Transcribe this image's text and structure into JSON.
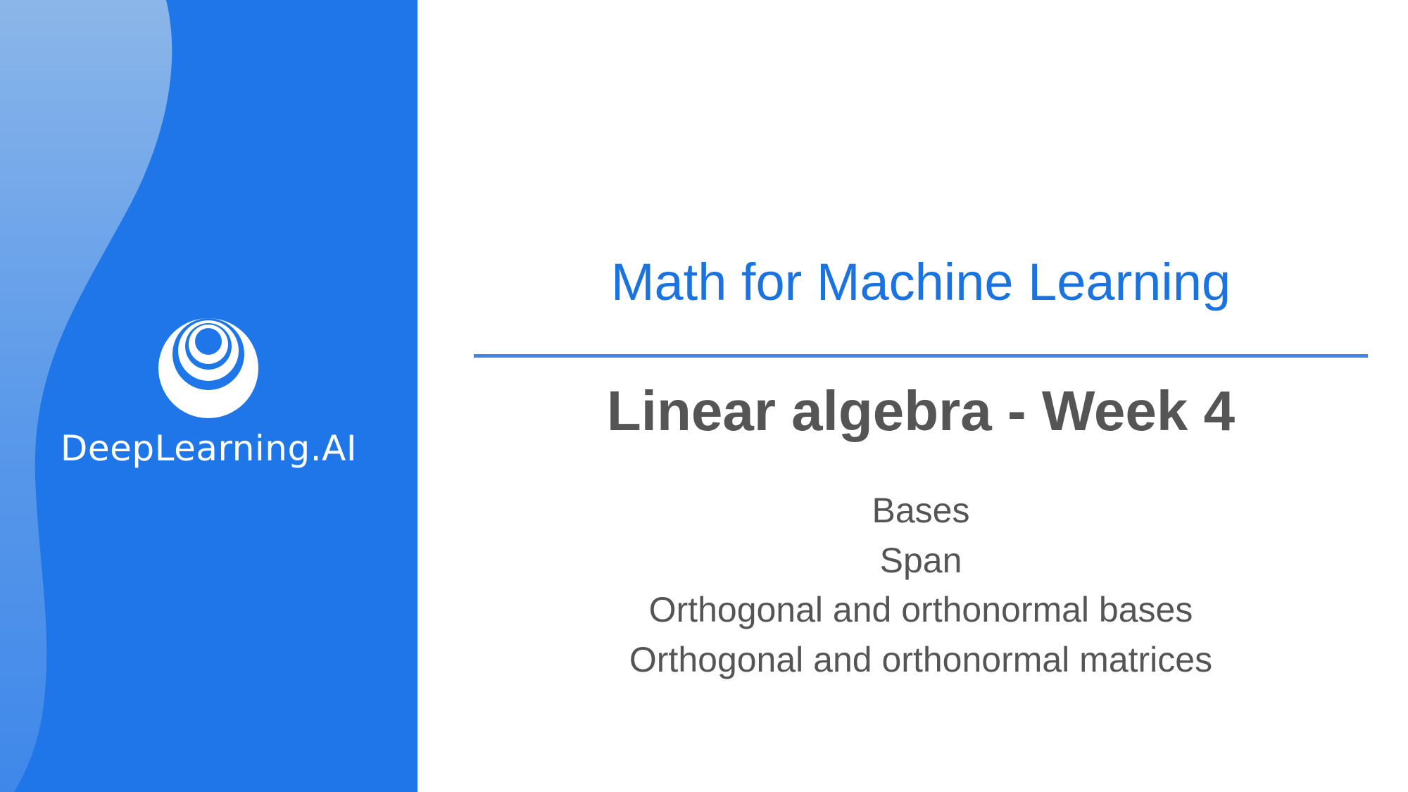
{
  "brand": {
    "name": "DeepLearning.AI",
    "logo_icon": "deeplearning-ai-logo-icon"
  },
  "course": {
    "title": "Math for Machine Learning"
  },
  "lesson": {
    "title": "Linear algebra - Week 4",
    "topics": [
      "Bases",
      "Span",
      "Orthogonal and orthonormal bases",
      "Orthogonal and orthonormal matrices"
    ]
  },
  "colors": {
    "panel_blue": "#1e76e8",
    "wave_light_blue": "#7fb0e8",
    "title_blue": "#1a73e0",
    "divider_blue": "#3e86e8",
    "text_gray": "#555555"
  }
}
